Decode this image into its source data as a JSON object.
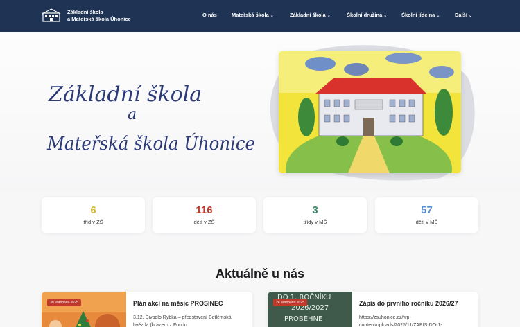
{
  "header": {
    "brand_line1": "Základní škola",
    "brand_line2": "a Mateřská škola Úhonice",
    "nav": [
      {
        "label": "O nás",
        "has_dropdown": false
      },
      {
        "label": "Mateřská škola",
        "has_dropdown": true
      },
      {
        "label": "Základní škola",
        "has_dropdown": true
      },
      {
        "label": "Školní družina",
        "has_dropdown": true
      },
      {
        "label": "Školní jídelna",
        "has_dropdown": true
      },
      {
        "label": "Další",
        "has_dropdown": true
      }
    ]
  },
  "hero": {
    "line1": "Základní škola",
    "line2": "a",
    "line3": "Mateřská škola Úhonice"
  },
  "stats": [
    {
      "value": "6",
      "label": "tříd v ZŠ",
      "color": "#d4b63a"
    },
    {
      "value": "116",
      "label": "dětí v ZŠ",
      "color": "#c0392b"
    },
    {
      "value": "3",
      "label": "třídy v MŠ",
      "color": "#3d8b6a"
    },
    {
      "value": "57",
      "label": "dětí v MŠ",
      "color": "#5b8fd1"
    }
  ],
  "news": {
    "title": "Aktuálně u nás",
    "items": [
      {
        "date": "30. listopadu 2025",
        "title": "Plán akcí na měsíc PROSINEC",
        "excerpt": "3.12.  Divadlo Rybka – představení Betlémská hvězda (brazero z Fondu"
      },
      {
        "date": "24. listopadu 2025",
        "title": "Zápis do prvního ročníku 2026/27",
        "excerpt": "https://zsuhonice.cz/wp-content/uploads/2025/11/ZAPIS-DO-1-",
        "thumb_text1": "DO 1. ROČNÍKU",
        "thumb_text2": "2026/2027",
        "thumb_text3": "PROBĚHNE"
      }
    ]
  },
  "colors": {
    "header_bg": "#1f3354",
    "accent_red": "#c0392b"
  }
}
